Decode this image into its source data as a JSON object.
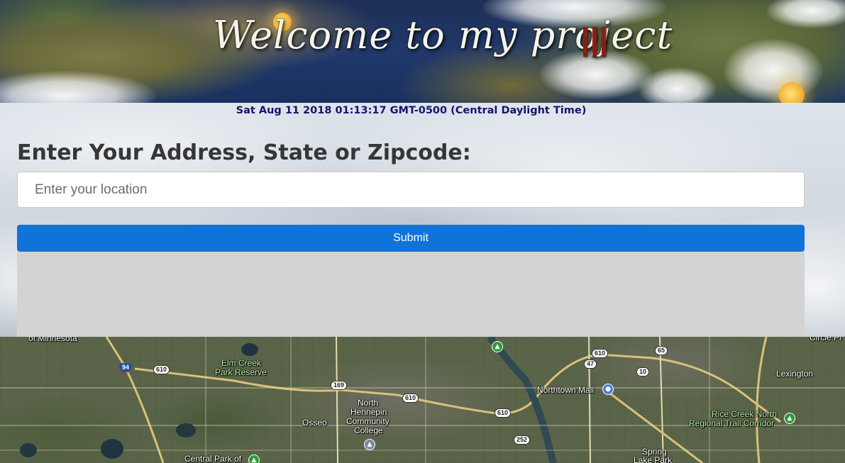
{
  "header": {
    "title": "Welcome to my project"
  },
  "clock": {
    "datetime": "Sat Aug 11 2018 01:13:17 GMT-0500 (Central Daylight Time)"
  },
  "form": {
    "heading": "Enter Your Address, State or Zipcode:",
    "location_placeholder": "Enter your location",
    "location_value": "",
    "submit_label": "Submit"
  },
  "map": {
    "labels": {
      "minnesota": "of Minnesota",
      "elm_creek_1": "Elm Creek",
      "elm_creek_2": "Park Reserve",
      "osseo": "Osseo",
      "north": "North",
      "hennepin": "Hennepin",
      "community": "Community",
      "college": "College",
      "northtown": "Northtown Mall",
      "lexington": "Lexington",
      "rice_creek_1": "Rice Creek North",
      "rice_creek_2": "Regional Trail Corridor",
      "spring": "Spring",
      "lake_park": "Lake Park",
      "central_park": "Central Park of",
      "circle_pines": "Circle Pi"
    },
    "shields": {
      "i94": "94",
      "r610_a": "610",
      "r610_b": "610",
      "r610_c": "610",
      "r610_d": "610",
      "r169": "169",
      "r47": "47",
      "r65": "65",
      "r10": "10",
      "r252": "252"
    }
  },
  "colors": {
    "accent": "#0f73d9",
    "date_text": "#15156b",
    "banner_bars": "#8c1d12",
    "results_panel": "#d3d3d3"
  }
}
